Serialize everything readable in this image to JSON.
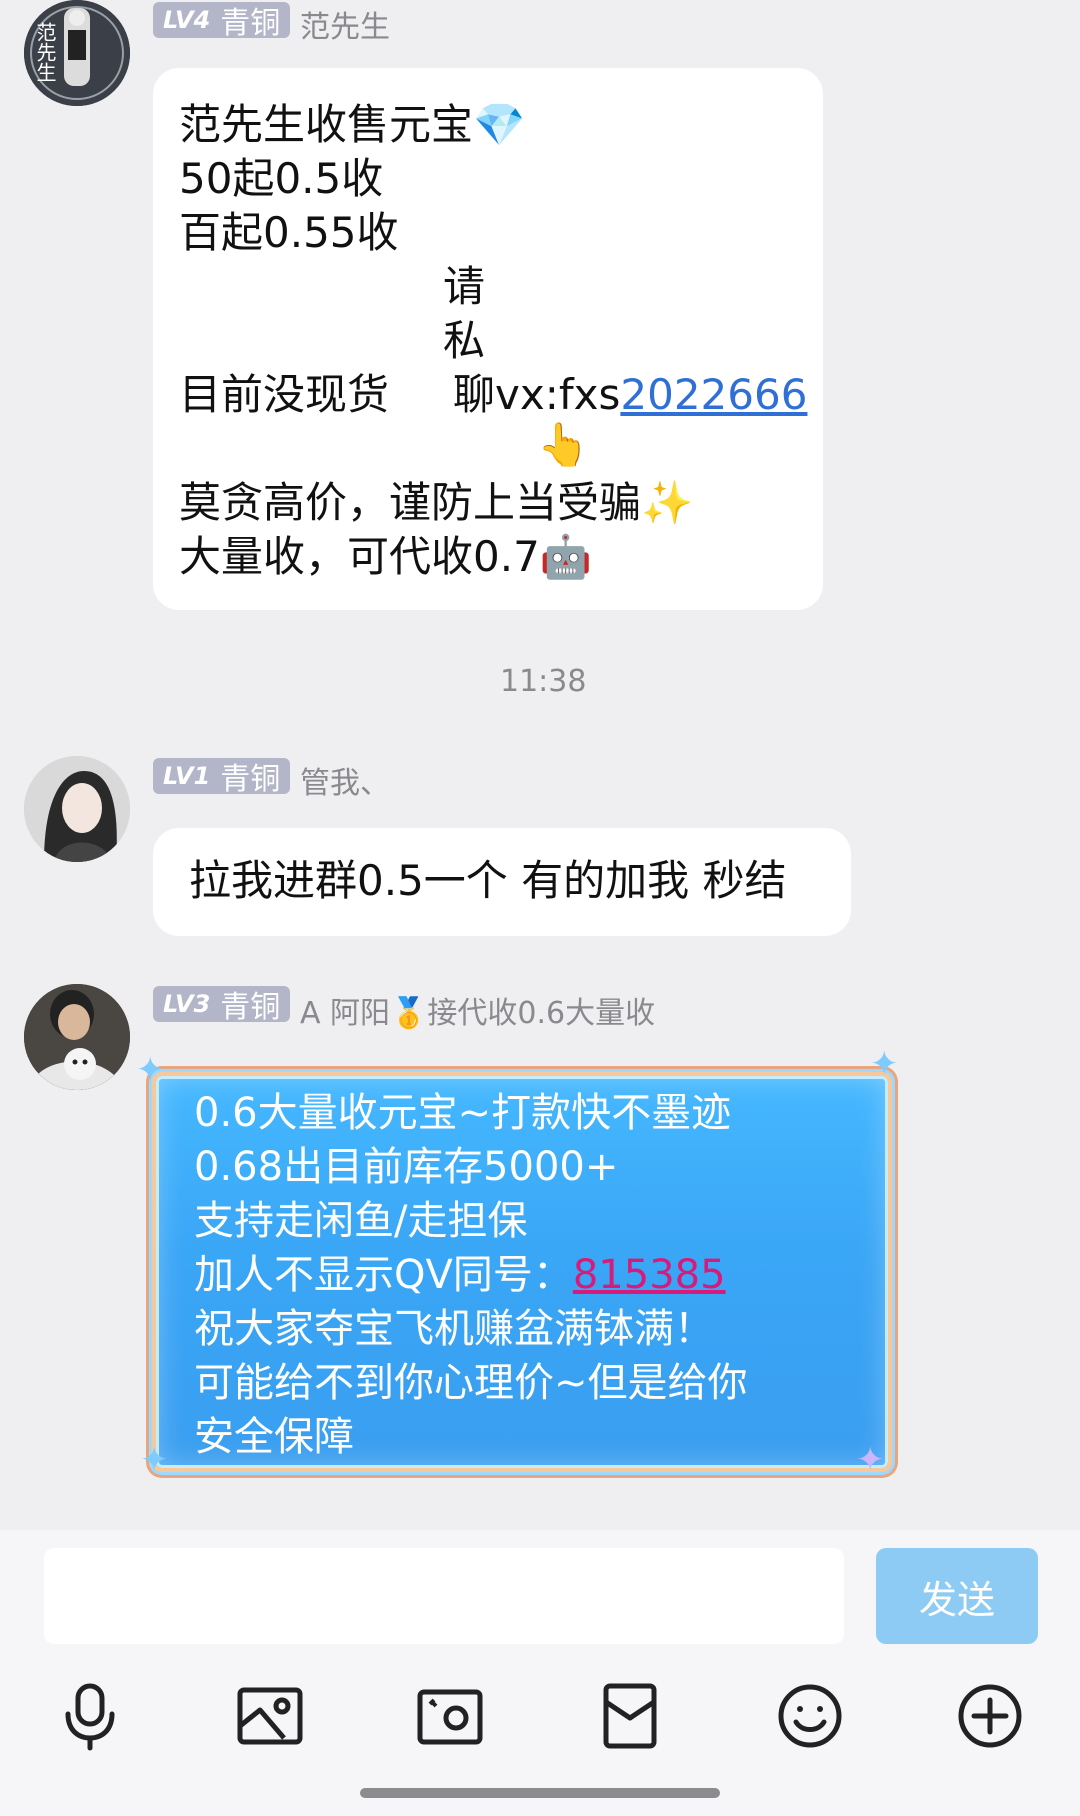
{
  "messages": [
    {
      "level": "LV4",
      "rank": "青铜",
      "nickname": "范先生",
      "avatar_text": "范先生",
      "lines": [
        "范先生收售元宝",
        "50起0.5收",
        "百起0.55收",
        "请",
        "私",
        "目前没现货",
        "聊vx:fxs",
        "2022666",
        "莫贪高价，谨防上当受骗",
        "大量收，可代收0.7"
      ],
      "emojis": {
        "diamond": "💎",
        "pointing": "👆",
        "sparkles": "✨",
        "robot": "🤖"
      }
    },
    {
      "level": "LV1",
      "rank": "青铜",
      "nickname": "管我、",
      "text": "拉我进群0.5一个 有的加我 秒结"
    },
    {
      "level": "LV3",
      "rank": "青铜",
      "nickname": "A 阿阳",
      "nickname_suffix": "接代收0.6大量收",
      "medal": "🥇",
      "lines": [
        "0.6大量收元宝~打款快不墨迹",
        "0.68出目前库存5000+",
        "支持走闲鱼/走担保",
        "加人不显示QV同号：",
        "815385",
        "祝大家夺宝飞机赚盆满钵满！",
        "可能给不到你心理价~但是给你",
        "安全保障"
      ]
    }
  ],
  "timestamp": "11:38",
  "input": {
    "placeholder": "",
    "send_label": "发送"
  },
  "toolbar": [
    "microphone-icon",
    "image-icon",
    "camera-icon",
    "red-packet-icon",
    "emoji-icon",
    "plus-icon"
  ],
  "colors": {
    "link": "#2f6fd6",
    "qv_link": "#d81b7a",
    "send_bg": "#8ecbf4",
    "badge_bg": "#b3b6c8"
  }
}
